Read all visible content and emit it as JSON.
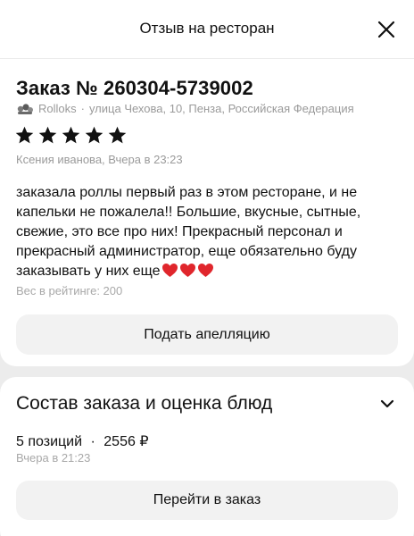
{
  "header": {
    "title": "Отзыв на ресторан"
  },
  "review": {
    "order_title": "Заказ № 260304-5739002",
    "restaurant_name": "Rolloks",
    "address": "улица Чехова, 10, Пенза, Российская Федерация",
    "rating_stars": 5,
    "author": "Ксения иванова, Вчера в 23:23",
    "text": "заказала роллы первый раз в этом ресторане, и не капельки не пожалела!! Большие, вкусные, сытные, свежие, это все про них! Прекрасный персонал и прекрасный администратор, еще обязательно буду заказывать у них еще",
    "emoji": "❤️❤️❤️",
    "weight": "Вес в рейтинге: 200",
    "appeal_button": "Подать апелляцию"
  },
  "order": {
    "title": "Состав заказа и оценка блюд",
    "positions": "5 позиций",
    "separator": "·",
    "total": "2556 ₽",
    "time": "Вчера в 21:23",
    "goto_button": "Перейти в заказ"
  },
  "colors": {
    "star": "#111111",
    "heart": "#e0262c",
    "muted_text": "#9a9a9a",
    "button_bg": "#f2f2f2"
  }
}
